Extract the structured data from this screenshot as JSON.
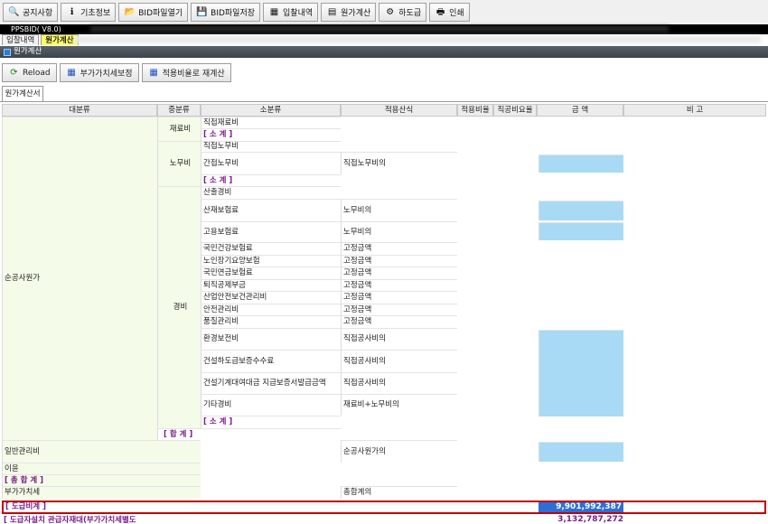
{
  "toolbar": {
    "buttons": [
      {
        "label": "공지사항",
        "icon": "search-icon"
      },
      {
        "label": "기초정보",
        "icon": "info-icon"
      },
      {
        "label": "BID파일열기",
        "icon": "folder-open-icon"
      },
      {
        "label": "BID파일저장",
        "icon": "save-icon"
      },
      {
        "label": "입찰내역",
        "icon": "list-icon"
      },
      {
        "label": "원가계산",
        "icon": "calculator-icon"
      },
      {
        "label": "하도급",
        "icon": "network-icon"
      },
      {
        "label": "인쇄",
        "icon": "print-icon"
      }
    ]
  },
  "app": {
    "title": "PPSBID( V8.0)"
  },
  "tabs": [
    {
      "label": "입찰내역"
    },
    {
      "label": "원가계산"
    }
  ],
  "section": {
    "title": "원가계산"
  },
  "actions": [
    {
      "label": "Reload",
      "icon": "reload-icon"
    },
    {
      "label": "부가가치세보정",
      "icon": "tax-adjust-icon"
    },
    {
      "label": "적용비율로 재계산",
      "icon": "recalc-icon"
    }
  ],
  "inner_tab": {
    "label": "원가계산서"
  },
  "grid": {
    "headers": [
      "대분류",
      "중분류",
      "소분류",
      "적용산식",
      "적용비율",
      "직공비요율",
      "금 액",
      "비 고"
    ],
    "groups": {
      "main1": "순공사원가",
      "material": "재료비",
      "labor": "노무비",
      "expense": "경비",
      "general": "일반관리비",
      "profit": "이윤",
      "total_sum": "[ 총 합 계 ]",
      "vat": "부가가치세",
      "contract_total": "[ 도급비계 ]",
      "final": "[ 도급자설치 관급자재대(부가가치세별도"
    },
    "rows": {
      "direct_material": "직접재료비",
      "subtotal": "[ 소 계 ]",
      "direct_labor": "직접노무비",
      "indirect_labor": "간접노무비",
      "indirect_labor_formula": "직접노무비의",
      "expense_items": [
        {
          "name": "산출경비",
          "formula": ""
        },
        {
          "name": "산재보험료",
          "formula": "노무비의"
        },
        {
          "name": "고용보험료",
          "formula": "노무비의"
        },
        {
          "name": "국민건강보험료",
          "formula": "고정금액"
        },
        {
          "name": "노인장기요양보험",
          "formula": "고정금액"
        },
        {
          "name": "국민연금보험료",
          "formula": "고정금액"
        },
        {
          "name": "퇴직공제부금",
          "formula": "고정금액"
        },
        {
          "name": "산업안전보건관리비",
          "formula": "고정금액"
        },
        {
          "name": "안전관리비",
          "formula": "고정금액"
        },
        {
          "name": "품질관리비",
          "formula": "고정금액"
        },
        {
          "name": "환경보전비",
          "formula": "직접공사비의"
        },
        {
          "name": "건설하도급보증수수료",
          "formula": "직접공사비의"
        },
        {
          "name": "건설기계대여대금 지급보증서발급금액",
          "formula": "직접공사비의"
        },
        {
          "name": "기타경비",
          "formula": "재료비+노무비의"
        }
      ],
      "total": "[ 합 계 ]",
      "general_formula": "순공사원가의",
      "vat_formula": "총합계의"
    },
    "amounts": {
      "contract_total": "9,901,992,387",
      "final": "3,132,787,272"
    }
  }
}
